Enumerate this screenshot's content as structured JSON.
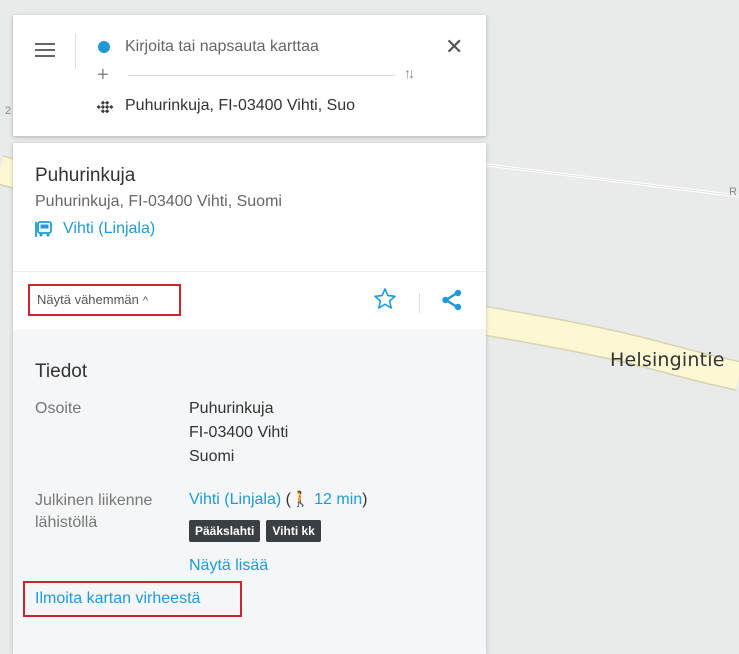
{
  "search": {
    "origin_placeholder": "Kirjoita tai napsauta karttaa",
    "add_via_symbol": "+",
    "swap_symbol": "↑↓",
    "close_symbol": "✕",
    "destination": "Puhurinkuja, FI-03400 Vihti, Suo"
  },
  "place": {
    "title": "Puhurinkuja",
    "subtitle": "Puhurinkuja, FI-03400 Vihti, Suomi",
    "stop_link": "Vihti (Linjala)"
  },
  "actions": {
    "toggle_label": "Näytä vähemmän",
    "toggle_chevron": "^"
  },
  "details": {
    "title": "Tiedot",
    "address_label": "Osoite",
    "address_lines": [
      "Puhurinkuja",
      "FI-03400 Vihti",
      "Suomi"
    ],
    "transit_label_1": "Julkinen liikenne",
    "transit_label_2": "lähistöllä",
    "transit_stop": "Vihti (Linjala)",
    "open_paren": "(",
    "walk_time": "12 min",
    "close_paren": ")",
    "chips": [
      "Pääkslahti",
      "Vihti kk"
    ],
    "show_more": "Näytä lisää",
    "report_error": "Ilmoita kartan virheestä"
  },
  "map": {
    "road_label": "Helsingintie",
    "fragment_r": "R",
    "fragment_2": "2"
  },
  "colors": {
    "accent": "#1e9bd7",
    "highlight_box": "#cc2530",
    "road_fill": "#fdf8d4",
    "chip_bg": "#3a3f44"
  }
}
